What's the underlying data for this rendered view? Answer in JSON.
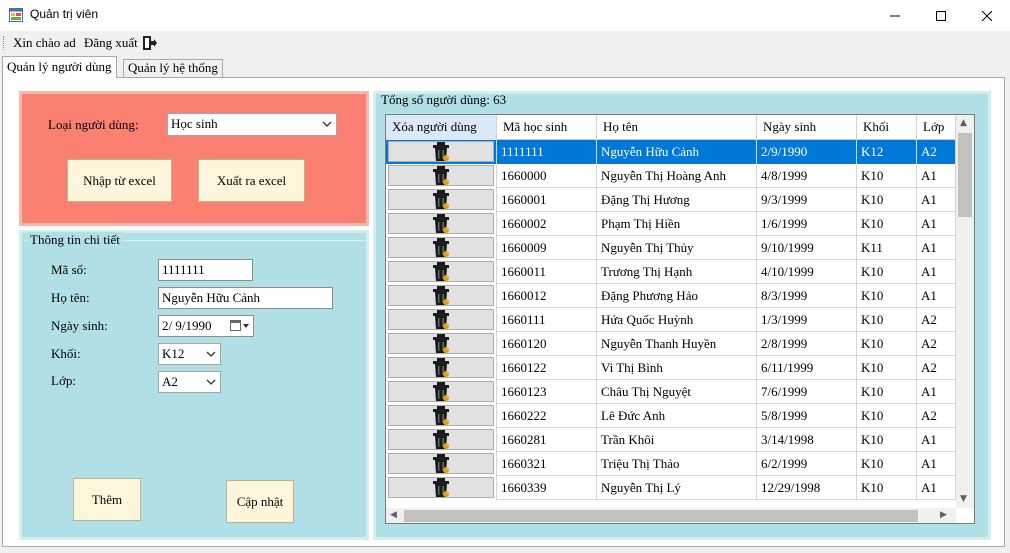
{
  "window": {
    "title": "Quản trị viên"
  },
  "menu": {
    "hello": "Xin chào ad",
    "logout": "Đăng xuất",
    "logout_icon": "exit-door-icon"
  },
  "tabs": [
    {
      "label": "Quản lý người dùng",
      "active": true
    },
    {
      "label": "Quản lý hệ thống",
      "active": false
    }
  ],
  "user_type": {
    "label": "Loại người dùng:",
    "value": "Học sinh",
    "import_button": "Nhập từ excel",
    "export_button": "Xuất ra excel"
  },
  "detail": {
    "group_title": "Thông tin chi tiết",
    "id_label": "Mã số:",
    "id_value": "1111111",
    "name_label": "Họ tên:",
    "name_value": "Nguyễn Hữu Cảnh",
    "dob_label": "Ngày sinh:",
    "dob_value": "2/  9/1990",
    "grade_label": "Khối:",
    "grade_value": "K12",
    "class_label": "Lớp:",
    "class_value": "A2",
    "add_button": "Thêm",
    "update_button": "Cập nhật"
  },
  "grid": {
    "count_text": "Tổng số người dùng: 63",
    "headers": [
      "Xóa người dùng",
      "Mã học sinh",
      "Họ tên",
      "Ngày sinh",
      "Khối",
      "Lớp"
    ],
    "selected_row": 0,
    "rows": [
      {
        "id": "1111111",
        "name": "Nguyễn Hữu Cảnh",
        "dob": "2/9/1990",
        "grade": "K12",
        "class": "A2"
      },
      {
        "id": "1660000",
        "name": "Nguyễn Thị Hoàng Anh",
        "dob": "4/8/1999",
        "grade": "K10",
        "class": "A1"
      },
      {
        "id": "1660001",
        "name": "Đặng Thị Hương",
        "dob": "9/3/1999",
        "grade": "K10",
        "class": "A1"
      },
      {
        "id": "1660002",
        "name": "Phạm Thị Hiền",
        "dob": "1/6/1999",
        "grade": "K10",
        "class": "A1"
      },
      {
        "id": "1660009",
        "name": "Nguyễn Thị Thủy",
        "dob": "9/10/1999",
        "grade": "K11",
        "class": "A1"
      },
      {
        "id": "1660011",
        "name": "Trương Thị Hạnh",
        "dob": "4/10/1999",
        "grade": "K10",
        "class": "A1"
      },
      {
        "id": "1660012",
        "name": "Đặng Phương Hảo",
        "dob": "8/3/1999",
        "grade": "K10",
        "class": "A1"
      },
      {
        "id": "1660111",
        "name": "Hứa Quốc Huỳnh",
        "dob": "1/3/1999",
        "grade": "K10",
        "class": "A2"
      },
      {
        "id": "1660120",
        "name": "Nguyễn Thanh Huyền",
        "dob": "2/8/1999",
        "grade": "K10",
        "class": "A2"
      },
      {
        "id": "1660122",
        "name": "Vi Thị Bình",
        "dob": "6/11/1999",
        "grade": "K10",
        "class": "A2"
      },
      {
        "id": "1660123",
        "name": "Châu Thị Nguyệt",
        "dob": "7/6/1999",
        "grade": "K10",
        "class": "A1"
      },
      {
        "id": "1660222",
        "name": "Lê Đức Anh",
        "dob": "5/8/1999",
        "grade": "K10",
        "class": "A2"
      },
      {
        "id": "1660281",
        "name": "Trần Khôi",
        "dob": "3/14/1998",
        "grade": "K10",
        "class": "A1"
      },
      {
        "id": "1660321",
        "name": "Triệu Thị Thảo",
        "dob": "6/2/1999",
        "grade": "K10",
        "class": "A1"
      },
      {
        "id": "1660339",
        "name": "Nguyễn Thị Lý",
        "dob": "12/29/1998",
        "grade": "K10",
        "class": "A1"
      }
    ]
  },
  "colors": {
    "panel_salmon": "#fa8072",
    "panel_lightblue": "#b0dfe6",
    "button_cream": "#fdf6dc",
    "selection_blue": "#0078d7"
  }
}
